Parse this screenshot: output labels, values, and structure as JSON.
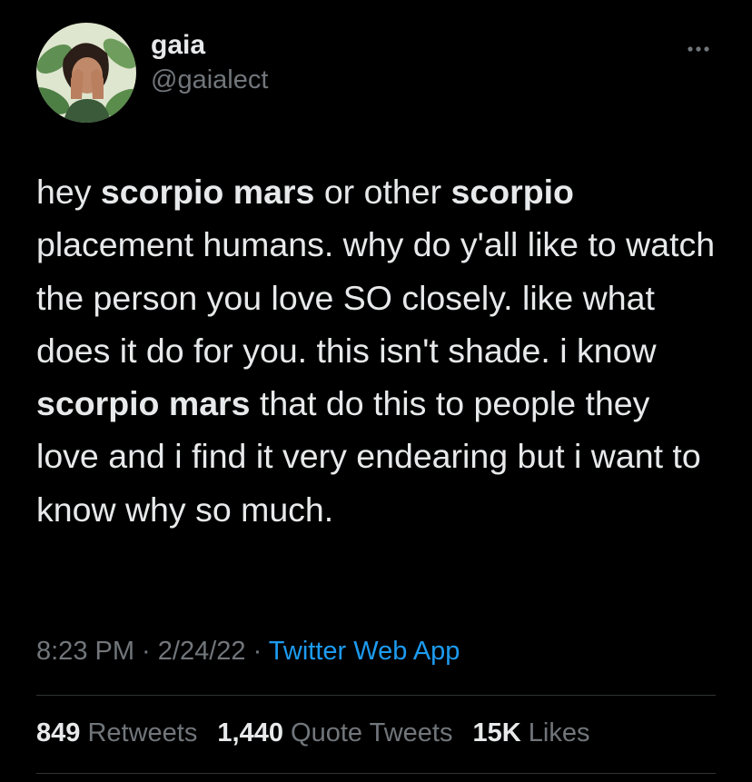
{
  "user": {
    "display_name": "gaia",
    "handle": "@gaialect",
    "avatar_icon": "avatar-illustration-icon"
  },
  "more_icon": "more-horizontal-icon",
  "tweet": {
    "segments": [
      {
        "text": "hey ",
        "bold": false
      },
      {
        "text": "scorpio mars",
        "bold": true
      },
      {
        "text": " or other ",
        "bold": false
      },
      {
        "text": "scorpio",
        "bold": true
      },
      {
        "text": " placement humans. why do y'all like to watch the person you love SO closely. like what does it do for you. this isn't shade. i know ",
        "bold": false
      },
      {
        "text": "scorpio mars",
        "bold": true
      },
      {
        "text": " that do this to people they love and i find it very endearing but i want to know why so much.",
        "bold": false
      }
    ]
  },
  "meta": {
    "time": "8:23 PM",
    "separator": " · ",
    "date": "2/24/22",
    "source": "Twitter Web App"
  },
  "stats": {
    "retweets_count": "849",
    "retweets_label": "Retweets",
    "quotes_count": "1,440",
    "quotes_label": "Quote Tweets",
    "likes_count": "15K",
    "likes_label": "Likes"
  },
  "colors": {
    "background": "#000000",
    "text": "#e7e9ea",
    "secondary": "#71767b",
    "link": "#1d9bf0",
    "divider": "#2f3336"
  }
}
